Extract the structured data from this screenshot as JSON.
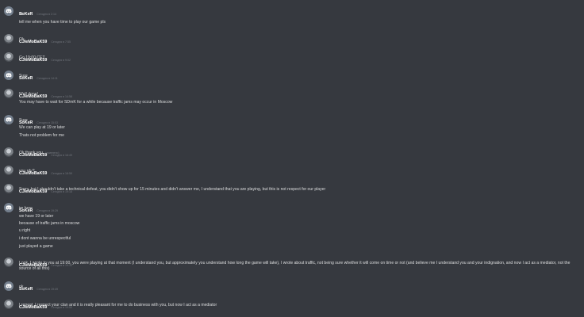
{
  "messages": [
    {
      "author": "SoKeR",
      "avatar": "discord",
      "time": "Сегодня в 2:14",
      "lines": [
        "hi",
        "tell me when you have time to play our game pls"
      ]
    },
    {
      "author": "CJleMoBaK59",
      "avatar": "photo",
      "time": "Сегодня в 7:55",
      "lines": [
        "Ok"
      ]
    },
    {
      "author": "CJleMoBaK59",
      "avatar": "photo",
      "time": "Сегодня в 9:02",
      "lines": [
        "Go 19:00 CET"
      ]
    },
    {
      "author": "SoKeR",
      "avatar": "discord",
      "time": "Сегодня в 14:11",
      "lines": [
        "Sure"
      ]
    },
    {
      "author": "CJleMoBaK59",
      "avatar": "photo",
      "time": "Сегодня в 14:58",
      "lines": [
        "Well done!",
        "You may have to wait for SDmK for a while because traffic jams may occur in Moscow"
      ]
    },
    {
      "author": "SoKeR",
      "avatar": "discord",
      "time": "Сегодня в 15:03",
      "lines": [
        "Sure",
        "We can play at 19 or later",
        "Thats not problem for me"
      ]
    },
    {
      "author": "CJleMoBaK59",
      "avatar": "photo",
      "time": "Сегодня в 16:49",
      "lines": [
        "Ok thank you"
      ],
      "edited": "(изменено)"
    },
    {
      "author": "CJleMoBaK59",
      "avatar": "photo",
      "time": "Сегодня в 18:59",
      "lines": [
        "you rdy?"
      ]
    },
    {
      "author": "CJleMoBaK59",
      "avatar": "photo",
      "time": "Сегодня в 19:18",
      "lines": [
        "Sorry, but I shouldn't take a technical defeat, you didn't show up for 15 minutes and didn't answer me, I understand that you are playing, but this is not respect for our player"
      ]
    },
    {
      "author": "SoKeR",
      "avatar": "discord",
      "time": "Сегодня в 19:29",
      "lines": [
        "im here",
        "we have 19 or later",
        "because of traffic jams in moscow",
        "u right",
        "i dont wanna be unrespectful",
        "just played a game"
      ]
    },
    {
      "author": "CJleMoBaK59",
      "avatar": "photo",
      "time": "Сегодня в 19:30",
      "lines": [
        "Look, I wrote to you at 19:00, you were playing at that moment (I understand you, but approximately you understand how long the game will take), I wrote about traffic, not being sure whether it will come on time or not (and believe me I understand you and your indignation, and now I act as a mediator, not the source of all this)"
      ]
    },
    {
      "author": "SoKeR",
      "avatar": "discord",
      "time": "Сегодня в 19:49",
      "lines": [
        "ok"
      ]
    },
    {
      "author": "CJleMoBaK59",
      "avatar": "photo",
      "time": "Сегодня в 19:50",
      "lines": [
        "I repeat, I respect your clan and it is really pleasant for me to do business with you, but now I act as a mediator"
      ]
    }
  ]
}
